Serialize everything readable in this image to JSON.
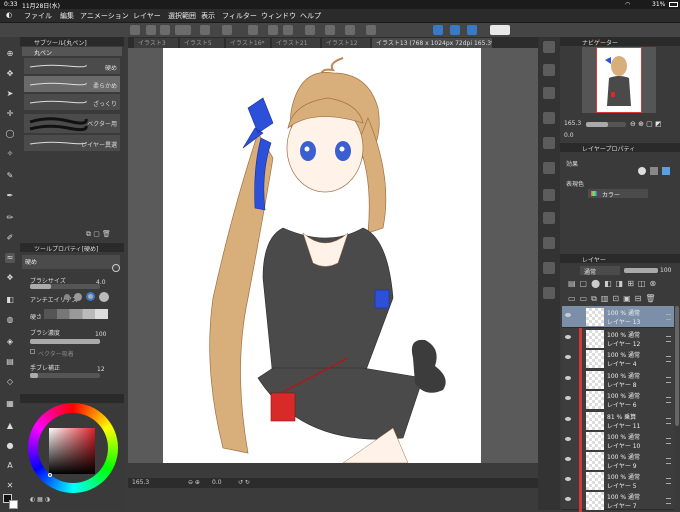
{
  "status": {
    "time": "0:33",
    "date": "11月28日(水)",
    "battery": "31%"
  },
  "menu": [
    "ファイル",
    "編集",
    "アニメーション",
    "レイヤー",
    "選択範囲",
    "表示",
    "フィルター",
    "ウィンドウ",
    "ヘルプ"
  ],
  "tabs": [
    {
      "label": "イラスト3"
    },
    {
      "label": "イラスト5"
    },
    {
      "label": "イラスト16*"
    },
    {
      "label": "イラスト21"
    },
    {
      "label": "イラスト12"
    },
    {
      "label": "イラスト13 (768 x 1024px 72dpi 165.3%)"
    }
  ],
  "subtool": {
    "header": "サブツール[丸ペン]",
    "group": "丸ペン",
    "brushes": [
      "硬め",
      "柔らかめ",
      "ざっくり",
      "ベクター用",
      "レイヤー異選"
    ]
  },
  "toolprop": {
    "header": "ツールプロパティ[硬め]",
    "preset": "硬め",
    "brush_size_label": "ブラシサイズ",
    "brush_size": "4.0",
    "aa_label": "アンチエイリアス",
    "hardness_label": "硬さ",
    "density_label": "ブラシ濃度",
    "density": "100",
    "vector_label": "ベクター吸着",
    "stabilize_label": "手ブレ補正",
    "stabilize": "12"
  },
  "navigator": {
    "header": "ナビゲーター",
    "zoom": "165.3",
    "angle": "0.0"
  },
  "layerprop": {
    "header": "レイヤープロパティ",
    "effect_label": "効果",
    "color_label": "表現色",
    "color_value": "カラー"
  },
  "layers": {
    "header": "レイヤー",
    "blend": "通常",
    "opacity": "100",
    "items": [
      {
        "mode": "100 % 通常",
        "name": "レイヤー 13"
      },
      {
        "mode": "100 % 通常",
        "name": "レイヤー 12"
      },
      {
        "mode": "100 % 通常",
        "name": "レイヤー 4"
      },
      {
        "mode": "100 % 通常",
        "name": "レイヤー 8"
      },
      {
        "mode": "100 % 通常",
        "name": "レイヤー 6"
      },
      {
        "mode": "81 % 乗算",
        "name": "レイヤー 11"
      },
      {
        "mode": "100 % 通常",
        "name": "レイヤー 10"
      },
      {
        "mode": "100 % 通常",
        "name": "レイヤー 9"
      },
      {
        "mode": "100 % 通常",
        "name": "レイヤー 5"
      },
      {
        "mode": "100 % 通常",
        "name": "レイヤー 7"
      }
    ]
  },
  "bottombar": {
    "zoom": "165.3",
    "angle": "0.0"
  }
}
